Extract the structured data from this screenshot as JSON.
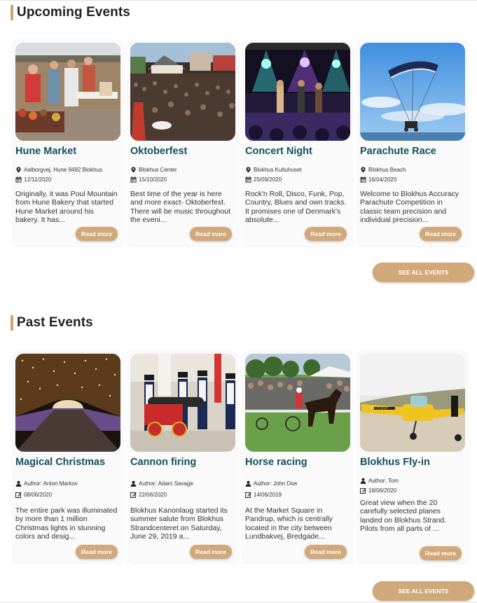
{
  "upcoming": {
    "title": "Upcoming Events",
    "see_all": "SEE ALL EVENTS",
    "events": [
      {
        "name": "Hune Market",
        "location": "Aalborgvej, Hune 9492 Blokhus",
        "date": "12/11/2020",
        "description": "Originally, it was Poul Mountain from Hune Bakery that started Hune Market around his bakery. It has...",
        "read_more": "Read more"
      },
      {
        "name": "Oktoberfest",
        "location": "Blokhus Center",
        "date": "15/10/2020",
        "description": "Best time of the year is here and more exact- Oktoberfest. There will be music throughout the eveni...",
        "read_more": "Read more"
      },
      {
        "name": "Concert Night",
        "location": "Blokhus Kultuhuset",
        "date": "25/09/2020",
        "description": "Rock'n Roll, Disco, Funk, Pop, Country, Blues and own tracks. It promises one of Denmark's absolute...",
        "read_more": "Read more"
      },
      {
        "name": "Parachute Race",
        "location": "Blokhus Beach",
        "date": "16/04/2020",
        "description": "Welcome to Blokhus Accuracy Parachute Competition in classic team precision and individual precision...",
        "read_more": "Read more"
      }
    ]
  },
  "past": {
    "title": "Past Events",
    "see_all": "SEE ALL EVENTS",
    "events": [
      {
        "name": "Magical Christmas",
        "author": "Author: Anton Markov",
        "date": "08/06/2020",
        "description": "The entire park was illuminated by more than 1 million Christmas lights in stunning colors and desig...",
        "read_more": "Read more"
      },
      {
        "name": "Cannon firing",
        "author": "Author: Adam Savage",
        "date": "22/06/2020",
        "description": "Blokhus Kanonlaug started its summer salute from Blokhus Strandcenteret on Saturday, June 29, 2019 a...",
        "read_more": "Read more"
      },
      {
        "name": "Horse racing",
        "author": "Author: John Doe",
        "date": "14/06/2019",
        "description": "At the Market Square in Pandrup, which is centrally located in the city between Lundbakvej, Bredgade...",
        "read_more": "Read more"
      },
      {
        "name": "Blokhus Fly-in",
        "author": "Author: Tom",
        "date": "18/06/2020",
        "description": "Great view when the 20 carefully selected planes landed on Blokhus Strand. Pilots from all parts of ...",
        "read_more": "Read more"
      }
    ]
  },
  "colors": {
    "accent": "#d1a366",
    "button": "#d1a87a",
    "title": "#15505f"
  },
  "icons": {
    "location": "map-pin-icon",
    "date": "calendar-icon",
    "author": "user-icon",
    "published": "edit-icon"
  }
}
